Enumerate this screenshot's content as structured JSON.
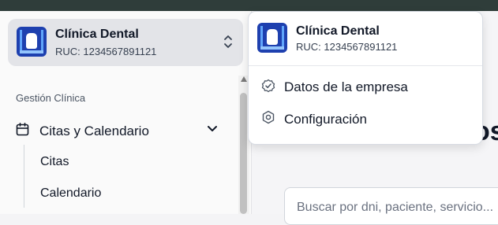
{
  "switcher": {
    "company_name": "Clínica Dental",
    "ruc": "RUC: 1234567891121",
    "logo_icon": "clinic-logo",
    "toggle_icon": "chevrons-up-down-icon"
  },
  "sidebar": {
    "section_label": "Gestión Clínica",
    "group": {
      "label": "Citas y Calendario",
      "icon": "calendar-icon",
      "expanded": true,
      "items": [
        {
          "label": "Citas"
        },
        {
          "label": "Calendario"
        }
      ]
    }
  },
  "main": {
    "heading_fragment": "os",
    "search_placeholder": "Buscar por dni, paciente, servicio..."
  },
  "dropdown": {
    "company_name": "Clínica Dental",
    "ruc": "RUC: 1234567891121",
    "items": [
      {
        "label": "Datos de la empresa",
        "icon": "badge-check-icon"
      },
      {
        "label": "Configuración",
        "icon": "settings-icon"
      }
    ]
  },
  "colors": {
    "topbar": "#2f3d3a",
    "switcher_bg": "#e3e4e8",
    "logo_bg": "#1e40af"
  }
}
